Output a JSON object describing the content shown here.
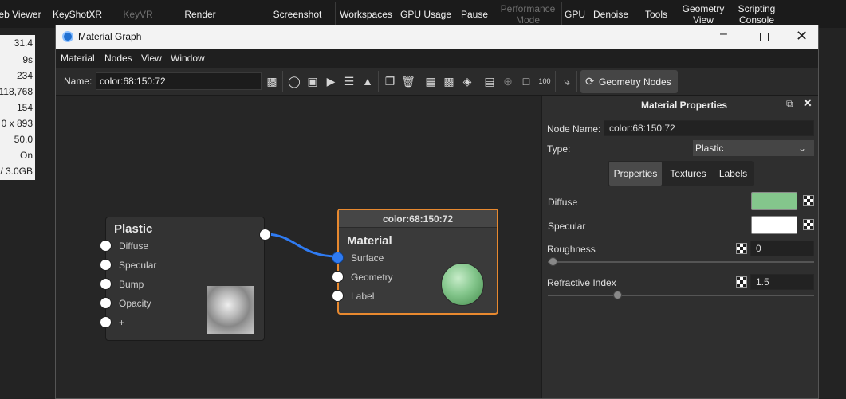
{
  "topbar": {
    "items": [
      {
        "label": "eb Viewer",
        "dim": false
      },
      {
        "label": "KeyShotXR",
        "dim": false
      },
      {
        "label": "KeyVR",
        "dim": true
      },
      {
        "label": "Render",
        "dim": false
      },
      {
        "label": "Screenshot",
        "dim": false
      },
      {
        "label": "Workspaces",
        "dim": false
      },
      {
        "label": "GPU Usage",
        "dim": false
      },
      {
        "label": "Pause",
        "dim": false
      },
      {
        "label": "Performance",
        "label2": "Mode",
        "dim": true
      },
      {
        "label": "GPU",
        "dim": false
      },
      {
        "label": "Denoise",
        "dim": false
      },
      {
        "label": "Tools",
        "dim": false
      },
      {
        "label": "Geometry",
        "label2": "View",
        "dim": false
      },
      {
        "label": "Scripting",
        "label2": "Console",
        "dim": false
      }
    ]
  },
  "stats": [
    "31.4",
    "9s",
    "234",
    "118,768",
    "154",
    "0 x 893",
    "50.0",
    "On",
    "/ 3.0GB"
  ],
  "window": {
    "title": "Material Graph",
    "menu": [
      "Material",
      "Nodes",
      "View",
      "Window"
    ],
    "name_label": "Name:",
    "name_value": "color:68:150:72",
    "geometry_nodes_label": "Geometry Nodes"
  },
  "graph": {
    "plastic_node": {
      "title": "Plastic",
      "inputs": [
        "Diffuse",
        "Specular",
        "Bump",
        "Opacity",
        "+"
      ]
    },
    "material_node": {
      "header": "color:68:150:72",
      "title": "Material",
      "inputs": [
        "Surface",
        "Geometry",
        "Label"
      ]
    }
  },
  "properties": {
    "title": "Material Properties",
    "node_name_label": "Node Name:",
    "node_name_value": "color:68:150:72",
    "type_label": "Type:",
    "type_value": "Plastic",
    "tabs": [
      "Properties",
      "Textures",
      "Labels"
    ],
    "active_tab": "Properties",
    "diffuse_label": "Diffuse",
    "diffuse_color": "#84c68c",
    "specular_label": "Specular",
    "specular_color": "#ffffff",
    "roughness_label": "Roughness",
    "roughness_value": "0",
    "refractive_label": "Refractive Index",
    "refractive_value": "1.5"
  },
  "colors": {
    "accent": "#2f7bf2",
    "selected_node_border": "#e8892f",
    "material_ball": "#84c68c"
  }
}
